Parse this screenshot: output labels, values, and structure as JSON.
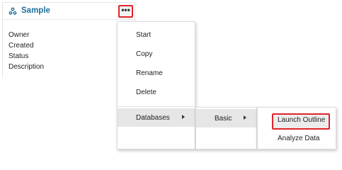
{
  "card": {
    "title": "Sample",
    "icon": "cube-cluster-icon",
    "actions_label": "•••",
    "fields": [
      "Owner",
      "Created",
      "Status",
      "Description"
    ]
  },
  "menu": {
    "items": [
      "Start",
      "Copy",
      "Rename",
      "Delete"
    ],
    "databases_label": "Databases"
  },
  "submenu": {
    "basic_label": "Basic"
  },
  "submenu2": {
    "launch_outline_label": "Launch Outline",
    "analyze_data_label": "Analyze Data"
  },
  "colors": {
    "accent": "#1c6f9c",
    "highlight_border": "#e0242c",
    "hover_background": "#e6e6e6"
  }
}
